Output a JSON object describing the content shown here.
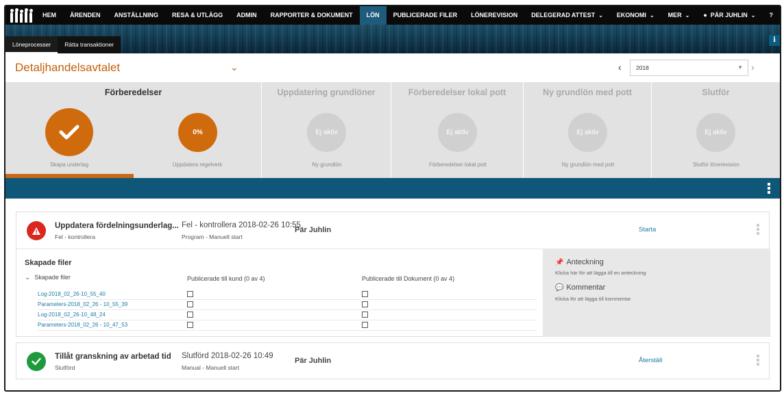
{
  "nav": {
    "items": [
      "HEM",
      "ÄRENDEN",
      "ANSTÄLLNING",
      "RESA & UTLÄGG",
      "ADMIN",
      "RAPPORTER & DOKUMENT",
      "LÖN",
      "PUBLICERADE FILER",
      "LÖNEREVISION"
    ],
    "delegerad": "DELEGERAD ATTEST",
    "ekonomi": "EKONOMI",
    "mer": "MER",
    "user": "PÄR JUHLIN",
    "help": "?"
  },
  "subtabs": [
    "Löneprocesser",
    "Rätta transaktioner"
  ],
  "header": {
    "agreement": "Detaljhandelsavtalet",
    "year": "2018"
  },
  "steps": [
    {
      "title": "Förberedelser",
      "sub1": "Skapa underlag",
      "sub2_value": "0%",
      "sub2": "Uppdatera regelverk"
    },
    {
      "title": "Uppdatering grundlöner",
      "circle": "Ej aktiv",
      "sub": "Ny grundlön"
    },
    {
      "title": "Förberedelser lokal pott",
      "circle": "Ej aktiv",
      "sub": "Förberedelser lokal pott"
    },
    {
      "title": "Ny grundlön med pott",
      "circle": "Ej aktiv",
      "sub": "Ny grundlön med pott"
    },
    {
      "title": "Slutför",
      "circle": "Ej aktiv",
      "sub": "Slutför lönerevision"
    }
  ],
  "tasks": [
    {
      "name": "Uppdatera fördelningsunderlag...",
      "status": "Fel - kontrollera",
      "time": "Fel - kontrollera 2018-02-26 10:55",
      "source": "Program - Manuell start",
      "user": "Pär Juhlin",
      "action": "Starta"
    },
    {
      "name": "Tillåt granskning av arbetad tid",
      "status": "Slutförd",
      "time": "Slutförd 2018-02-26 10:49",
      "source": "Manual - Manuell start",
      "user": "Pär Juhlin",
      "action": "Återställ"
    }
  ],
  "files": {
    "title": "Skapade filer",
    "toggle": "Skapade filer",
    "col1": "Publicerade till kund (0 av 4)",
    "col2": "Publicerade till Dokument (0 av 4)",
    "rows": [
      "Log-2018_02_26-10_55_40",
      "Parameters-2018_02_26 - 10_55_39",
      "Log-2018_02_26-10_48_24",
      "Parameters-2018_02_26 - 10_47_53"
    ]
  },
  "notes": {
    "anteckning": "Anteckning",
    "anteckning_sub": "Klicka här för att lägga till en anteckning",
    "kommentar": "Kommentar",
    "kommentar_sub": "Klicka för att lägga till kommentar"
  },
  "colors": {
    "accent": "#cf6b0d",
    "brand_blue": "#0f5778",
    "link": "#1a7aa6",
    "error": "#d9281e",
    "success": "#1e9a3c"
  }
}
